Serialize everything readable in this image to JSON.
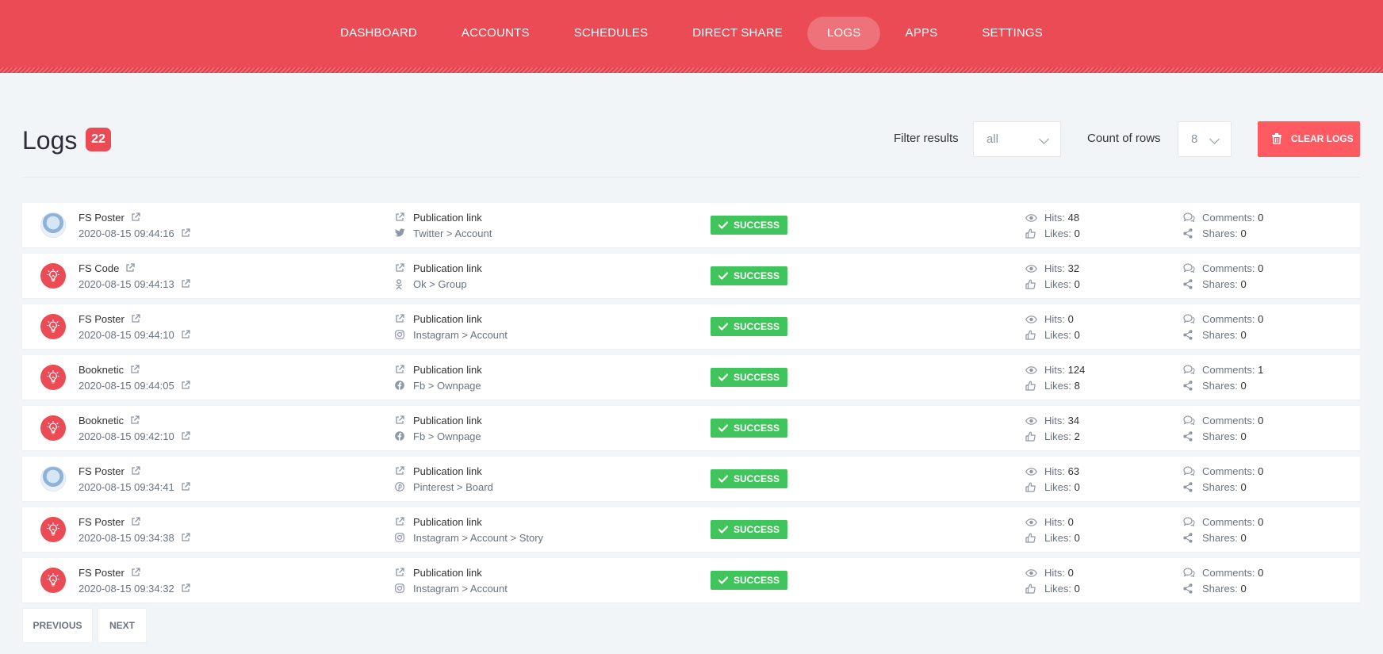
{
  "nav": {
    "items": [
      "DASHBOARD",
      "ACCOUNTS",
      "SCHEDULES",
      "DIRECT SHARE",
      "LOGS",
      "APPS",
      "SETTINGS"
    ],
    "active": "LOGS"
  },
  "page": {
    "title": "Logs",
    "count": "22",
    "filter_label": "Filter results",
    "filter_value": "all",
    "rows_label": "Count of rows",
    "rows_value": "8",
    "clear_label": "CLEAR LOGS"
  },
  "labels": {
    "publication_link": "Publication link",
    "status": "SUCCESS",
    "hits": "Hits:",
    "likes": "Likes:",
    "comments": "Comments:",
    "shares": "Shares:"
  },
  "logs": [
    {
      "name": "FS Poster",
      "date": "2020-08-15 09:44:16",
      "avatar": "photo",
      "network_icon": "twitter-icon",
      "network": "Twitter > Account",
      "hits": "48",
      "likes": "0",
      "comments": "0",
      "shares": "0"
    },
    {
      "name": "FS Code",
      "date": "2020-08-15 09:44:13",
      "avatar": "red",
      "network_icon": "ok-icon",
      "network": "Ok > Group",
      "hits": "32",
      "likes": "0",
      "comments": "0",
      "shares": "0"
    },
    {
      "name": "FS Poster",
      "date": "2020-08-15 09:44:10",
      "avatar": "red",
      "network_icon": "instagram-icon",
      "network": "Instagram > Account",
      "hits": "0",
      "likes": "0",
      "comments": "0",
      "shares": "0"
    },
    {
      "name": "Booknetic",
      "date": "2020-08-15 09:44:05",
      "avatar": "red",
      "network_icon": "facebook-icon",
      "network": "Fb > Ownpage",
      "hits": "124",
      "likes": "8",
      "comments": "1",
      "shares": "0"
    },
    {
      "name": "Booknetic",
      "date": "2020-08-15 09:42:10",
      "avatar": "red",
      "network_icon": "facebook-icon",
      "network": "Fb > Ownpage",
      "hits": "34",
      "likes": "2",
      "comments": "0",
      "shares": "0"
    },
    {
      "name": "FS Poster",
      "date": "2020-08-15 09:34:41",
      "avatar": "photo",
      "network_icon": "pinterest-icon",
      "network": "Pinterest > Board",
      "hits": "63",
      "likes": "0",
      "comments": "0",
      "shares": "0"
    },
    {
      "name": "FS Poster",
      "date": "2020-08-15 09:34:38",
      "avatar": "red",
      "network_icon": "instagram-icon",
      "network": "Instagram > Account > Story",
      "hits": "0",
      "likes": "0",
      "comments": "0",
      "shares": "0"
    },
    {
      "name": "FS Poster",
      "date": "2020-08-15 09:34:32",
      "avatar": "red",
      "network_icon": "instagram-icon",
      "network": "Instagram > Account",
      "hits": "0",
      "likes": "0",
      "comments": "0",
      "shares": "0"
    }
  ],
  "pagination": {
    "previous": "PREVIOUS",
    "next": "NEXT"
  },
  "colors": {
    "brand": "#ea4b54",
    "success": "#3fc55b",
    "clear": "#ff5a62"
  }
}
